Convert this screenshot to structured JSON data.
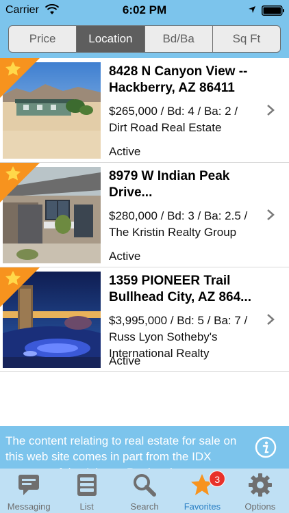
{
  "status_bar": {
    "carrier": "Carrier",
    "time": "6:02 PM"
  },
  "sort_control": {
    "segments": [
      "Price",
      "Location",
      "Bd/Ba",
      "Sq Ft"
    ],
    "selected": "Location"
  },
  "listings": [
    {
      "address": "8428 N Canyon View -- Hackberry, AZ 86411",
      "address_line1": "8428 N Canyon View --",
      "address_line2": "Hackberry, AZ 86411",
      "price_line1": "$265,000 / Bd: 4 / Ba: 2 /",
      "price_line2": "Dirt Road Real Estate",
      "price_line3": "",
      "status": "Active",
      "favorite": true
    },
    {
      "address": "8979 W Indian Peak Drive...",
      "address_line1": "8979 W Indian Peak",
      "address_line2": "Drive...",
      "price_line1": "$280,000 / Bd: 3 / Ba: 2.5 /",
      "price_line2": "The Kristin Realty Group",
      "price_line3": "",
      "status": "Active",
      "favorite": true
    },
    {
      "address": "1359 PIONEER Trail Bullhead City, AZ 864...",
      "address_line1": "1359 PIONEER Trail",
      "address_line2": "Bullhead City, AZ 864...",
      "price_line1": "$3,995,000 / Bd: 5 / Ba: 7 /",
      "price_line2": "Russ Lyon Sotheby's",
      "price_line3": "International Realty",
      "status": "Active",
      "favorite": true
    }
  ],
  "disclaimer": {
    "text": "The content relating to real estate for sale on this web site comes in part from the IDX program of the Arizona Regional..."
  },
  "tab_bar": {
    "tabs": [
      {
        "label": "Messaging",
        "icon": "message-icon"
      },
      {
        "label": "List",
        "icon": "list-icon"
      },
      {
        "label": "Search",
        "icon": "search-icon"
      },
      {
        "label": "Favorites",
        "icon": "star-icon",
        "badge": "3"
      },
      {
        "label": "Options",
        "icon": "gear-icon"
      }
    ],
    "active": "Favorites"
  },
  "colors": {
    "header_blue": "#7cc4ec",
    "tabbar_blue": "#bfe0f4",
    "favorite_orange": "#f7931e",
    "badge_red": "#e8312a"
  }
}
